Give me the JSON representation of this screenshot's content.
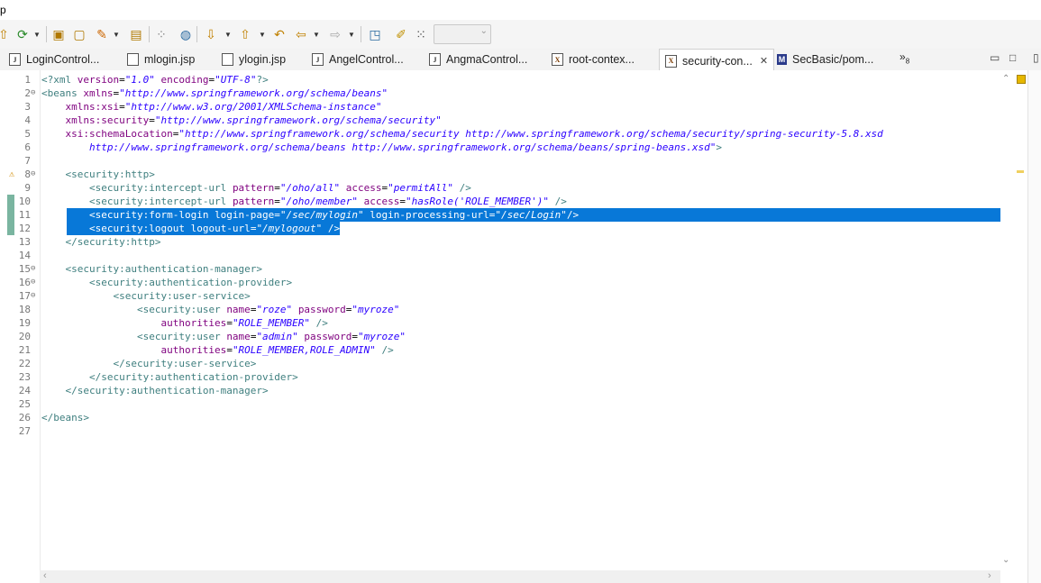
{
  "menu": {
    "char": "p"
  },
  "editor_tabs": [
    {
      "label": "LoginControl...",
      "icon": "java-file-icon",
      "glyph": "J"
    },
    {
      "label": "mlogin.jsp",
      "icon": "jsp-file-icon",
      "glyph": ""
    },
    {
      "label": "ylogin.jsp",
      "icon": "jsp-file-icon",
      "glyph": ""
    },
    {
      "label": "AngelControl...",
      "icon": "java-file-icon",
      "glyph": "J"
    },
    {
      "label": "AngmaControl...",
      "icon": "java-file-icon",
      "glyph": "J"
    },
    {
      "label": "root-contex...",
      "icon": "xml-file-icon",
      "glyph": "X"
    },
    {
      "label": "security-con...",
      "icon": "xml-file-icon",
      "glyph": "X",
      "active": true,
      "close": "✕"
    },
    {
      "label": "SecBasic/pom...",
      "icon": "maven-pom-icon",
      "glyph": "M"
    }
  ],
  "overflow": {
    "chevron": "»",
    "count": "8"
  },
  "code": [
    {
      "n": "1",
      "parts": [
        [
          "pi",
          "<?xml "
        ],
        [
          "attr",
          "version"
        ],
        [
          "plain",
          "="
        ],
        [
          "val",
          "\"1.0\""
        ],
        [
          "plain",
          " "
        ],
        [
          "attr",
          "encoding"
        ],
        [
          "plain",
          "="
        ],
        [
          "val",
          "\"UTF-8\""
        ],
        [
          "pi",
          "?>"
        ]
      ]
    },
    {
      "n": "2",
      "fold": "⊖",
      "parts": [
        [
          "tag",
          "<beans "
        ],
        [
          "attr",
          "xmlns"
        ],
        [
          "plain",
          "="
        ],
        [
          "val",
          "\"http://www.springframework.org/schema/beans\""
        ]
      ]
    },
    {
      "n": "3",
      "parts": [
        [
          "plain",
          "    "
        ],
        [
          "attr",
          "xmlns:xsi"
        ],
        [
          "plain",
          "="
        ],
        [
          "val",
          "\"http://www.w3.org/2001/XMLSchema-instance\""
        ]
      ]
    },
    {
      "n": "4",
      "parts": [
        [
          "plain",
          "    "
        ],
        [
          "attr",
          "xmlns:security"
        ],
        [
          "plain",
          "="
        ],
        [
          "val",
          "\"http://www.springframework.org/schema/security\""
        ]
      ]
    },
    {
      "n": "5",
      "parts": [
        [
          "plain",
          "    "
        ],
        [
          "attr",
          "xsi:schemaLocation"
        ],
        [
          "plain",
          "="
        ],
        [
          "val",
          "\"http://www.springframework.org/schema/security http://www.springframework.org/schema/security/spring-security-5.8.xsd"
        ]
      ]
    },
    {
      "n": "6",
      "parts": [
        [
          "plain",
          "        "
        ],
        [
          "val",
          "http://www.springframework.org/schema/beans http://www.springframework.org/schema/beans/spring-beans.xsd\""
        ],
        [
          "tag",
          ">"
        ]
      ]
    },
    {
      "n": "7",
      "parts": []
    },
    {
      "n": "8",
      "fold": "⊖",
      "warn": true,
      "parts": [
        [
          "plain",
          "    "
        ],
        [
          "tag",
          "<security:http>"
        ]
      ]
    },
    {
      "n": "9",
      "parts": [
        [
          "plain",
          "        "
        ],
        [
          "tag",
          "<security:intercept-url "
        ],
        [
          "attr",
          "pattern"
        ],
        [
          "plain",
          "="
        ],
        [
          "val",
          "\"/oho/all\""
        ],
        [
          "plain",
          " "
        ],
        [
          "attr",
          "access"
        ],
        [
          "plain",
          "="
        ],
        [
          "val",
          "\"permitAll\""
        ],
        [
          "plain",
          " "
        ],
        [
          "tag",
          "/>"
        ]
      ]
    },
    {
      "n": "10",
      "change": true,
      "parts": [
        [
          "plain",
          "        "
        ],
        [
          "tag",
          "<security:intercept-url "
        ],
        [
          "attr",
          "pattern"
        ],
        [
          "plain",
          "="
        ],
        [
          "val",
          "\"/oho/member\""
        ],
        [
          "plain",
          " "
        ],
        [
          "attr",
          "access"
        ],
        [
          "plain",
          "="
        ],
        [
          "val",
          "\"hasRole('ROLE_MEMBER')\""
        ],
        [
          "plain",
          " "
        ],
        [
          "tag",
          "/>"
        ]
      ]
    },
    {
      "n": "11",
      "change": true,
      "selected": "full",
      "parts": [
        [
          "plain",
          "        "
        ],
        [
          "tag",
          "<security:form-login "
        ],
        [
          "attr",
          "login-page"
        ],
        [
          "plain",
          "="
        ],
        [
          "val",
          "\"/sec/mylogin\""
        ],
        [
          "plain",
          " "
        ],
        [
          "attr",
          "login-processing-url"
        ],
        [
          "plain",
          "="
        ],
        [
          "val",
          "\"/sec/Login\""
        ],
        [
          "tag",
          "/>"
        ]
      ]
    },
    {
      "n": "12",
      "change": true,
      "selected": "part",
      "parts": [
        [
          "plain",
          "        "
        ],
        [
          "tag",
          "<security:logout "
        ],
        [
          "attr",
          "logout-url"
        ],
        [
          "plain",
          "="
        ],
        [
          "val",
          "\"/mylogout\""
        ],
        [
          "plain",
          " "
        ],
        [
          "tag",
          "/>"
        ]
      ]
    },
    {
      "n": "13",
      "parts": [
        [
          "plain",
          "    "
        ],
        [
          "tag",
          "</security:http>"
        ]
      ]
    },
    {
      "n": "14",
      "parts": []
    },
    {
      "n": "15",
      "fold": "⊖",
      "parts": [
        [
          "plain",
          "    "
        ],
        [
          "tag",
          "<security:authentication-manager>"
        ]
      ]
    },
    {
      "n": "16",
      "fold": "⊖",
      "parts": [
        [
          "plain",
          "        "
        ],
        [
          "tag",
          "<security:authentication-provider>"
        ]
      ]
    },
    {
      "n": "17",
      "fold": "⊖",
      "parts": [
        [
          "plain",
          "            "
        ],
        [
          "tag",
          "<security:user-service>"
        ]
      ]
    },
    {
      "n": "18",
      "parts": [
        [
          "plain",
          "                "
        ],
        [
          "tag",
          "<security:user "
        ],
        [
          "attr",
          "name"
        ],
        [
          "plain",
          "="
        ],
        [
          "val",
          "\"roze\""
        ],
        [
          "plain",
          " "
        ],
        [
          "attr",
          "password"
        ],
        [
          "plain",
          "="
        ],
        [
          "val",
          "\"myroze\""
        ]
      ]
    },
    {
      "n": "19",
      "parts": [
        [
          "plain",
          "                    "
        ],
        [
          "attr",
          "authorities"
        ],
        [
          "plain",
          "="
        ],
        [
          "val",
          "\"ROLE_MEMBER\""
        ],
        [
          "plain",
          " "
        ],
        [
          "tag",
          "/>"
        ]
      ]
    },
    {
      "n": "20",
      "parts": [
        [
          "plain",
          "                "
        ],
        [
          "tag",
          "<security:user "
        ],
        [
          "attr",
          "name"
        ],
        [
          "plain",
          "="
        ],
        [
          "val",
          "\"admin\""
        ],
        [
          "plain",
          " "
        ],
        [
          "attr",
          "password"
        ],
        [
          "plain",
          "="
        ],
        [
          "val",
          "\"myroze\""
        ]
      ]
    },
    {
      "n": "21",
      "parts": [
        [
          "plain",
          "                    "
        ],
        [
          "attr",
          "authorities"
        ],
        [
          "plain",
          "="
        ],
        [
          "val",
          "\"ROLE_MEMBER,ROLE_ADMIN\""
        ],
        [
          "plain",
          " "
        ],
        [
          "tag",
          "/>"
        ]
      ]
    },
    {
      "n": "22",
      "parts": [
        [
          "plain",
          "            "
        ],
        [
          "tag",
          "</security:user-service>"
        ]
      ]
    },
    {
      "n": "23",
      "parts": [
        [
          "plain",
          "        "
        ],
        [
          "tag",
          "</security:authentication-provider>"
        ]
      ]
    },
    {
      "n": "24",
      "parts": [
        [
          "plain",
          "    "
        ],
        [
          "tag",
          "</security:authentication-manager>"
        ]
      ]
    },
    {
      "n": "25",
      "parts": []
    },
    {
      "n": "26",
      "parts": [
        [
          "tag",
          "</beans>"
        ]
      ]
    },
    {
      "n": "27",
      "parts": []
    }
  ],
  "colors": {
    "selection": "#0878d8",
    "tag": "#3f7f7f",
    "attribute": "#7f007f",
    "value": "#2a00ff"
  }
}
